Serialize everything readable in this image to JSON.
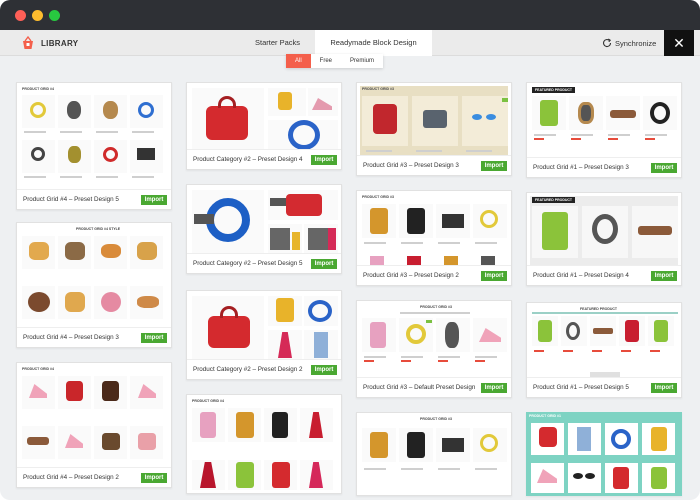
{
  "logo": {
    "text": "LIBRARY",
    "icon": "basket-icon"
  },
  "tabs": [
    {
      "label": "Starter Packs"
    },
    {
      "label": "Readymade Block Design"
    }
  ],
  "sync": {
    "label": "Synchronize",
    "icon": "sync-icon"
  },
  "close": {
    "label": "✕"
  },
  "filters": [
    {
      "label": "All"
    },
    {
      "label": "Free"
    },
    {
      "label": "Premium"
    }
  ],
  "import_label": "Import",
  "cards": [
    {
      "title": "Product Grid #4 – Preset Design 5"
    },
    {
      "title": "Product Grid #4 – Preset Design 3"
    },
    {
      "title": "Product Grid #4 – Preset Design 2"
    },
    {
      "title": "Product Category #2 – Preset Design 4"
    },
    {
      "title": "Product Category #2 – Preset Design 5"
    },
    {
      "title": "Product Category #2 – Preset Design 2"
    },
    {
      "title": "Product Grid #3 – Preset Design 3"
    },
    {
      "title": "Product Grid #3 – Preset Design 2"
    },
    {
      "title": "Product Grid #3 – Default Preset Design"
    },
    {
      "title": "Product Grid #1 – Preset Design 3"
    },
    {
      "title": "Product Grid #1 – Preset Design 4"
    },
    {
      "title": "Product Grid #1 – Preset Design 5"
    }
  ]
}
